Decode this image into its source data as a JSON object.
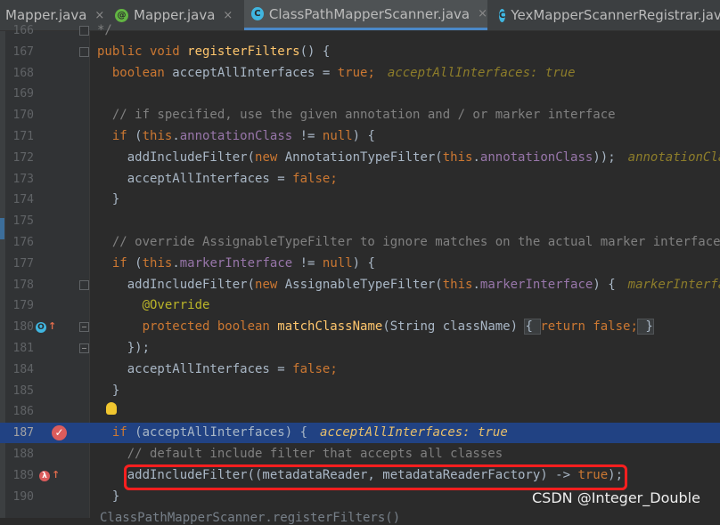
{
  "tabs": [
    {
      "label": "Mapper.java"
    },
    {
      "label": "Mapper.java"
    },
    {
      "label": "ClassPathMapperScanner.java"
    },
    {
      "label": "YexMapperScannerRegistrar.java"
    }
  ],
  "tab_close_glyph": "×",
  "lines": [
    {
      "num": "166",
      "tokens": [
        {
          "t": "*/",
          "c": "cmt"
        }
      ]
    },
    {
      "num": "167",
      "tokens": [
        {
          "t": "public void ",
          "c": "kw"
        },
        {
          "t": "registerFilters",
          "c": "mth"
        },
        {
          "t": "() {",
          "c": "p"
        }
      ]
    },
    {
      "num": "168",
      "tokens": [
        {
          "t": "  boolean ",
          "c": "kw"
        },
        {
          "t": "acceptAllInterfaces = ",
          "c": "p"
        },
        {
          "t": "true",
          "c": "kw"
        },
        {
          "t": ";",
          "c": "kw"
        }
      ],
      "hint": "acceptAllInterfaces: true"
    },
    {
      "num": "169",
      "tokens": []
    },
    {
      "num": "170",
      "tokens": [
        {
          "t": "  // if specified, use the given annotation and / or marker interface",
          "c": "cmt"
        }
      ]
    },
    {
      "num": "171",
      "tokens": [
        {
          "t": "  if ",
          "c": "kw"
        },
        {
          "t": "(",
          "c": "p"
        },
        {
          "t": "this",
          "c": "kw"
        },
        {
          "t": ".",
          "c": "p"
        },
        {
          "t": "annotationClass",
          "c": "fld"
        },
        {
          "t": " != ",
          "c": "p"
        },
        {
          "t": "null",
          "c": "kw"
        },
        {
          "t": ") {",
          "c": "p"
        }
      ]
    },
    {
      "num": "172",
      "tokens": [
        {
          "t": "    addIncludeFilter(",
          "c": "p"
        },
        {
          "t": "new ",
          "c": "kw"
        },
        {
          "t": "AnnotationTypeFilter(",
          "c": "p"
        },
        {
          "t": "this",
          "c": "kw"
        },
        {
          "t": ".",
          "c": "p"
        },
        {
          "t": "annotationClass",
          "c": "fld"
        },
        {
          "t": "));",
          "c": "p"
        }
      ],
      "hint": "annotationClass"
    },
    {
      "num": "173",
      "tokens": [
        {
          "t": "    acceptAllInterfaces = ",
          "c": "p"
        },
        {
          "t": "false",
          "c": "kw"
        },
        {
          "t": ";",
          "c": "kw"
        }
      ]
    },
    {
      "num": "174",
      "tokens": [
        {
          "t": "  }",
          "c": "p"
        }
      ]
    },
    {
      "num": "175",
      "tokens": []
    },
    {
      "num": "176",
      "tokens": [
        {
          "t": "  // override AssignableTypeFilter to ignore matches on the actual marker interface",
          "c": "cmt"
        }
      ]
    },
    {
      "num": "177",
      "tokens": [
        {
          "t": "  if ",
          "c": "kw"
        },
        {
          "t": "(",
          "c": "p"
        },
        {
          "t": "this",
          "c": "kw"
        },
        {
          "t": ".",
          "c": "p"
        },
        {
          "t": "markerInterface",
          "c": "fld"
        },
        {
          "t": " != ",
          "c": "p"
        },
        {
          "t": "null",
          "c": "kw"
        },
        {
          "t": ") {",
          "c": "p"
        }
      ]
    },
    {
      "num": "178",
      "tokens": [
        {
          "t": "    addIncludeFilter(",
          "c": "p"
        },
        {
          "t": "new ",
          "c": "kw"
        },
        {
          "t": "AssignableTypeFilter(",
          "c": "p"
        },
        {
          "t": "this",
          "c": "kw"
        },
        {
          "t": ".",
          "c": "p"
        },
        {
          "t": "markerInterface",
          "c": "fld"
        },
        {
          "t": ") {",
          "c": "p"
        }
      ],
      "hint": "markerInterface"
    },
    {
      "num": "179",
      "tokens": [
        {
          "t": "      @Override",
          "c": "ann"
        }
      ]
    },
    {
      "num": "180",
      "tokens": [
        {
          "t": "      protected boolean ",
          "c": "kw"
        },
        {
          "t": "matchClassName",
          "c": "mth"
        },
        {
          "t": "(String className) ",
          "c": "p"
        },
        {
          "t": "{ ",
          "c": "brace"
        },
        {
          "t": "return false",
          "c": "kw"
        },
        {
          "t": ";",
          "c": "kw"
        },
        {
          "t": " }",
          "c": "brace"
        }
      ]
    },
    {
      "num": "181",
      "tokens": [
        {
          "t": "    });",
          "c": "p"
        }
      ]
    },
    {
      "num": "184",
      "tokens": [
        {
          "t": "    acceptAllInterfaces = ",
          "c": "p"
        },
        {
          "t": "false",
          "c": "kw"
        },
        {
          "t": ";",
          "c": "kw"
        }
      ]
    },
    {
      "num": "185",
      "tokens": [
        {
          "t": "  }",
          "c": "p"
        }
      ]
    },
    {
      "num": "186",
      "tokens": []
    },
    {
      "num": "187",
      "tokens": [
        {
          "t": "  if ",
          "c": "kw"
        },
        {
          "t": "(acceptAllInterfaces) {",
          "c": "p"
        }
      ],
      "hint": "acceptAllInterfaces: true",
      "selected": true
    },
    {
      "num": "188",
      "tokens": [
        {
          "t": "    // default include filter that accepts all classes",
          "c": "cmt"
        }
      ]
    },
    {
      "num": "189",
      "tokens": [
        {
          "t": "    addIncludeFilter((metadataReader, metadataReaderFactory) -> ",
          "c": "p"
        },
        {
          "t": "true",
          "c": "kw"
        },
        {
          "t": ");",
          "c": "p"
        }
      ]
    },
    {
      "num": "190",
      "tokens": [
        {
          "t": "  }",
          "c": "p"
        }
      ]
    }
  ],
  "cutoff_line": "ClassPathMapperScanner.registerFilters()",
  "watermark": "CSDN @Integer_Double",
  "colors": {
    "selection": "#214283",
    "accent": "#4a88c7",
    "breakpoint": "#db5c5c",
    "highlight_box": "#ff1f1f"
  }
}
